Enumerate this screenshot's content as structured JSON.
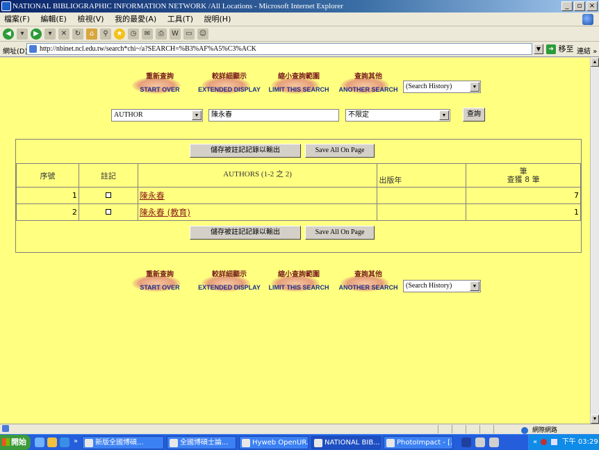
{
  "window": {
    "title": "NATIONAL BIBLIOGRAPHIC INFORMATION NETWORK /All Locations - Microsoft Internet Explorer",
    "min": "_",
    "max": "▫",
    "close": "×"
  },
  "menu": {
    "items": [
      "檔案(F)",
      "編輯(E)",
      "檢視(V)",
      "我的最愛(A)",
      "工具(T)",
      "說明(H)"
    ]
  },
  "address": {
    "label": "網址(D)",
    "url": "http://nbinet.ncl.edu.tw/search*chi~/a?SEARCH=%B3%AF%A5%C3%ACK",
    "go_label": "移至",
    "links_label": "連結 »"
  },
  "nav": {
    "start_over": {
      "zh": "重新查詢",
      "en": "START OVER"
    },
    "extended_display": {
      "zh": "較詳細顯示",
      "en": "EXTENDED DISPLAY"
    },
    "limit_search": {
      "zh": "縮小查詢範圍",
      "en": "LIMIT THIS SEARCH"
    },
    "another_search": {
      "zh": "查詢其他",
      "en": "ANOTHER SEARCH"
    },
    "history_select": "(Search History)"
  },
  "search": {
    "field_select": "AUTHOR",
    "query": "陳永春",
    "scope_select": "不限定",
    "submit_label": "查詢"
  },
  "results": {
    "save_marked_label": "儲存被註記記錄以輸出",
    "save_all_label": "Save All On Page",
    "headers": {
      "seq": "序號",
      "mark": "註記",
      "authors": "AUTHORS (1-2 之 2)",
      "year": "出版年",
      "count_top": "筆",
      "count_bottom": "查獲 8 筆"
    },
    "rows": [
      {
        "seq": "1",
        "author": "陳永春",
        "year": "",
        "count": "7"
      },
      {
        "seq": "2",
        "author": "陳永春 (教育)",
        "year": "",
        "count": "1"
      }
    ]
  },
  "status": {
    "zone": "網際網路"
  },
  "taskbar": {
    "start": "開始",
    "chevron": "»",
    "tasks": [
      "新版全國博碩...",
      "全國博碩士論...",
      "Hyweb OpenUR...",
      "NATIONAL BIB...",
      "PhotoImpact - [..."
    ],
    "clock": "下午 03:29",
    "tray_prefix": "«"
  }
}
